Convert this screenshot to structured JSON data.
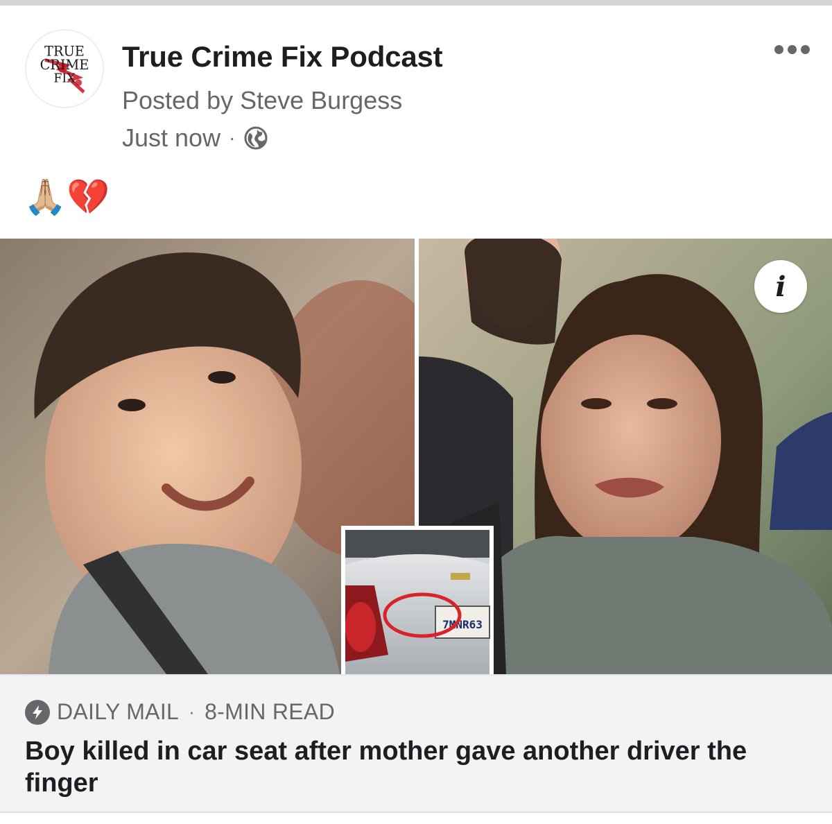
{
  "post": {
    "page_name": "True Crime Fix Podcast",
    "posted_by": "Posted by Steve Burgess",
    "timestamp": "Just now",
    "separator": "·",
    "privacy_icon": "globe-icon",
    "more_icon": "more-options-icon",
    "text": "🙏🏼💔"
  },
  "avatar": {
    "logo_lines": [
      "TRUE",
      "CRIME",
      "FIX"
    ],
    "logo_color": "#1a1a1a",
    "accent_color": "#c8141e"
  },
  "link": {
    "info_label": "i",
    "source": "DAILY MAIL",
    "read_time": "8-MIN READ",
    "separator": "·",
    "source_icon": "lightning-bolt-icon",
    "headline": "Boy killed in car seat after mother gave another driver the finger",
    "inset_plate": "7MNR63"
  },
  "colors": {
    "primary_text": "#1c1e21",
    "secondary_text": "#65676b",
    "footer_bg": "#f2f3f5",
    "circle_highlight": "#d9232c"
  }
}
